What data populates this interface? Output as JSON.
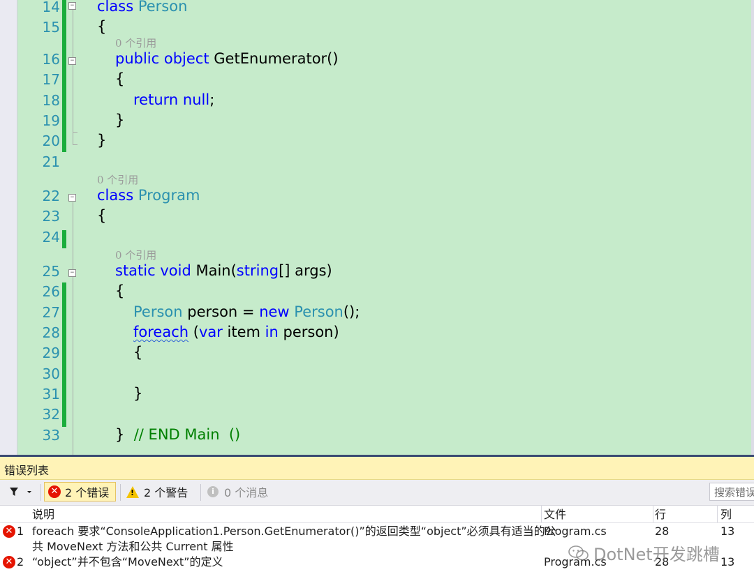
{
  "editor": {
    "lines": [
      {
        "num": "14",
        "ref": "",
        "tokens": [
          [
            "kw",
            "class "
          ],
          [
            "ty",
            "Person"
          ]
        ]
      },
      {
        "num": "15",
        "ref": "",
        "tokens": [
          [
            "tx",
            "{"
          ]
        ]
      },
      {
        "num": "16",
        "ref": "0 个引用",
        "tokens": [
          [
            "kw",
            "public "
          ],
          [
            "kw",
            "object "
          ],
          [
            "tx",
            "GetEnumerator()"
          ]
        ]
      },
      {
        "num": "17",
        "ref": "",
        "tokens": [
          [
            "tx",
            "{"
          ]
        ]
      },
      {
        "num": "18",
        "ref": "",
        "tokens": [
          [
            "kw",
            "return "
          ],
          [
            "kw",
            "null"
          ],
          [
            "tx",
            ";"
          ]
        ]
      },
      {
        "num": "19",
        "ref": "",
        "tokens": [
          [
            "tx",
            "}"
          ]
        ]
      },
      {
        "num": "20",
        "ref": "",
        "tokens": [
          [
            "tx",
            "}"
          ]
        ]
      },
      {
        "num": "21",
        "ref": "",
        "tokens": []
      },
      {
        "num": "22",
        "ref": "0 个引用",
        "tokens": [
          [
            "kw",
            "class "
          ],
          [
            "ty",
            "Program"
          ]
        ]
      },
      {
        "num": "23",
        "ref": "",
        "tokens": [
          [
            "tx",
            "{"
          ]
        ]
      },
      {
        "num": "24",
        "ref": "",
        "tokens": []
      },
      {
        "num": "25",
        "ref": "0 个引用",
        "tokens": [
          [
            "kw",
            "static "
          ],
          [
            "kw",
            "void "
          ],
          [
            "tx",
            "Main("
          ],
          [
            "kw",
            "string"
          ],
          [
            "tx",
            "[] args)"
          ]
        ]
      },
      {
        "num": "26",
        "ref": "",
        "tokens": [
          [
            "tx",
            "{"
          ]
        ]
      },
      {
        "num": "27",
        "ref": "",
        "tokens": [
          [
            "ty",
            "Person "
          ],
          [
            "tx",
            "person = "
          ],
          [
            "kw",
            "new "
          ],
          [
            "ty",
            "Person"
          ],
          [
            "tx",
            "();"
          ]
        ]
      },
      {
        "num": "28",
        "ref": "",
        "tokens": [
          [
            "kwsq",
            "foreach"
          ],
          [
            "tx",
            " ("
          ],
          [
            "kw",
            "var "
          ],
          [
            "tx",
            "item "
          ],
          [
            "kw",
            "in "
          ],
          [
            "tx",
            "person)"
          ]
        ]
      },
      {
        "num": "29",
        "ref": "",
        "tokens": [
          [
            "tx",
            "{"
          ]
        ]
      },
      {
        "num": "30",
        "ref": "",
        "tokens": []
      },
      {
        "num": "31",
        "ref": "",
        "tokens": [
          [
            "tx",
            "}"
          ]
        ]
      },
      {
        "num": "32",
        "ref": "",
        "tokens": []
      },
      {
        "num": "33",
        "ref": "",
        "tokens": [
          [
            "tx",
            "}  "
          ],
          [
            "cm",
            "// END Main  ()"
          ]
        ]
      }
    ]
  },
  "error_list": {
    "title": "错误列表",
    "toolbar": {
      "errors_label": "2 个错误",
      "warnings_label": "2 个警告",
      "messages_label": "0 个消息",
      "search_placeholder": "搜索错误列表"
    },
    "columns": {
      "description": "说明",
      "file": "文件",
      "line": "行",
      "column": "列"
    },
    "rows": [
      {
        "num": "1",
        "desc1": "foreach 要求“ConsoleApplication1.Person.GetEnumerator()”的返回类型“object”必须具有适当的公",
        "desc2": "共 MoveNext 方法和公共 Current 属性",
        "file": "Program.cs",
        "line": "28",
        "col": "13"
      },
      {
        "num": "2",
        "desc1": "“object”并不包含“MoveNext”的定义",
        "desc2": "",
        "file": "Program.cs",
        "line": "28",
        "col": "13"
      }
    ]
  },
  "watermark": {
    "text": "DotNet开发跳槽"
  },
  "colors": {
    "keyword": "#0000ff",
    "type": "#2b91af",
    "comment": "#008000",
    "editor_bg": "#c6ebcb",
    "change_bar": "#1aad3c",
    "error": "#e51400",
    "warning": "#f5c400",
    "panel_header": "#fff3b7"
  },
  "icons": [
    "filter-icon",
    "dropdown-arrow-icon",
    "error-icon",
    "warning-icon",
    "info-icon",
    "collapse-icon",
    "wechat-icon"
  ]
}
